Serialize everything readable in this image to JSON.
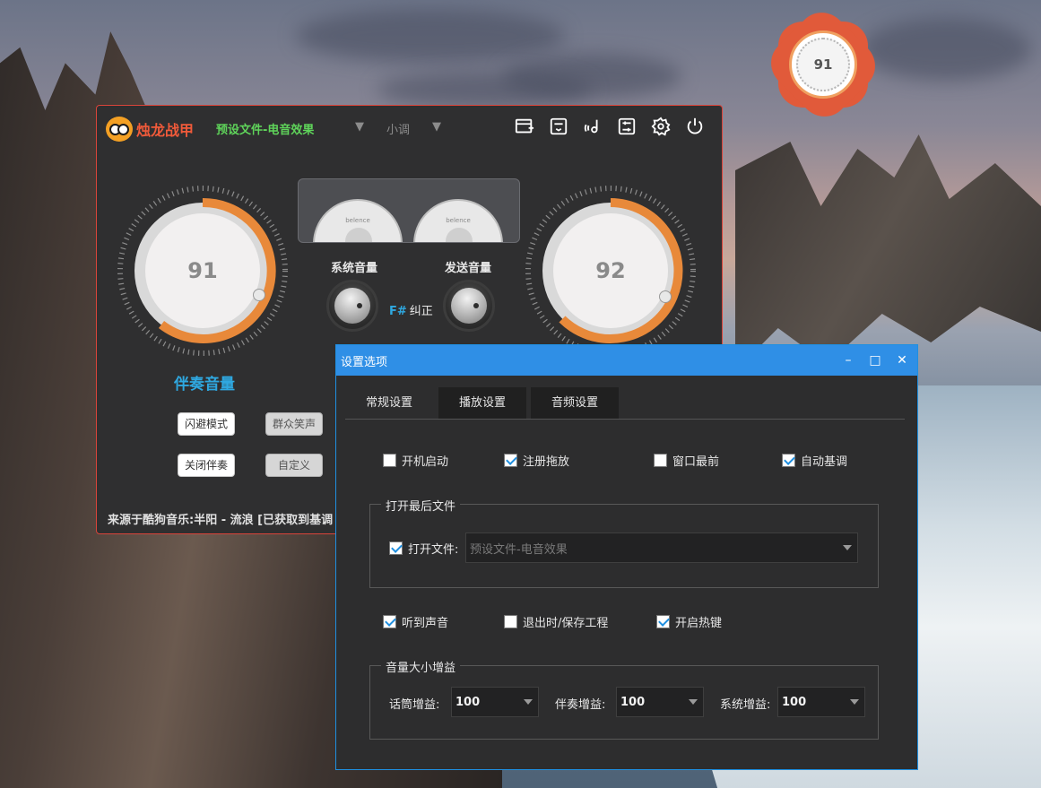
{
  "desktop_widget": {
    "value": "91",
    "icon": "volume-gauge-icon"
  },
  "app": {
    "name": "烛龙战甲",
    "preset": "预设文件-电音效果",
    "mode": "小调",
    "toolbar": [
      {
        "name": "add-window-button",
        "icon": "add-window-icon"
      },
      {
        "name": "save-button",
        "icon": "save-icon"
      },
      {
        "name": "sound-effect-button",
        "icon": "sound-effect-icon"
      },
      {
        "name": "mixer-button",
        "icon": "mixer-icon"
      },
      {
        "name": "settings-button",
        "icon": "gear-icon"
      },
      {
        "name": "power-button",
        "icon": "power-icon"
      }
    ],
    "left_knob": {
      "value": "91",
      "level": 0.91
    },
    "right_knob": {
      "value": "92",
      "level": 0.92
    },
    "meter_label_left": "belence",
    "meter_label_right": "belence",
    "system_volume_label": "系统音量",
    "send_volume_label": "发送音量",
    "key_note": "F#",
    "key_fix": "纠正",
    "accompaniment_label": "伴奏音量",
    "buttons": {
      "avoid_mode": "闪避模式",
      "crowd_laugh": "群众笑声",
      "close_accompaniment": "关闭伴奏",
      "custom": "自定义"
    },
    "source_text": "来源于酷狗音乐:半阳 - 流浪 [已获取到基调"
  },
  "dialog": {
    "title": "设置选项",
    "controls": {
      "minimize": "–",
      "maximize": "□",
      "close": "✕"
    },
    "tabs": [
      "常规设置",
      "播放设置",
      "音频设置"
    ],
    "active_tab": 0,
    "options_row1": [
      {
        "label": "开机启动",
        "checked": false
      },
      {
        "label": "注册拖放",
        "checked": true
      },
      {
        "label": "窗口最前",
        "checked": false
      },
      {
        "label": "自动基调",
        "checked": true
      }
    ],
    "open_last_group": {
      "title": "打开最后文件",
      "checkbox": {
        "label": "打开文件:",
        "checked": true
      },
      "file_value": "预设文件-电音效果"
    },
    "options_row2": [
      {
        "label": "听到声音",
        "checked": true
      },
      {
        "label": "退出时/保存工程",
        "checked": false
      },
      {
        "label": "开启热键",
        "checked": true
      }
    ],
    "gain_group": {
      "title": "音量大小增益",
      "items": [
        {
          "label": "话筒增益:",
          "value": "100"
        },
        {
          "label": "伴奏增益:",
          "value": "100"
        },
        {
          "label": "系统增益:",
          "value": "100"
        }
      ]
    }
  },
  "colors": {
    "accent_blue": "#2f8fe6",
    "brand_orange": "#f05a3a",
    "preset_green": "#5fd45a",
    "knob_arc": "#e8893a"
  }
}
